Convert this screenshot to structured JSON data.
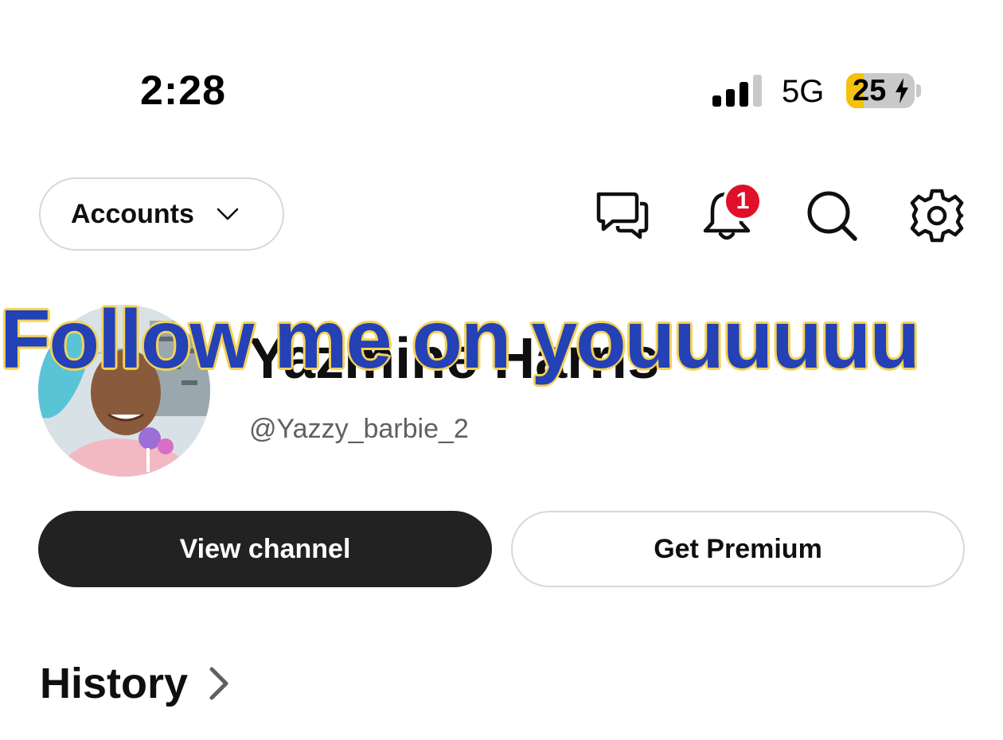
{
  "status_bar": {
    "time": "2:28",
    "network": "5G",
    "battery_level": "25",
    "battery_fraction": 0.25,
    "signal_bars_filled": 3,
    "signal_bars_total": 4
  },
  "header": {
    "accounts_label": "Accounts",
    "icons": [
      "messages-icon",
      "bell-icon",
      "search-icon",
      "gear-icon"
    ],
    "notification_count": "1"
  },
  "profile": {
    "name": "Yazmine Harris",
    "handle": "@Yazzy_barbie_2"
  },
  "overlay": {
    "caption": "Follow me on youuuuuu"
  },
  "actions": {
    "view_channel": "View channel",
    "get_premium": "Get Premium"
  },
  "sections": {
    "history_title": "History"
  },
  "colors": {
    "primary_button": "#222222",
    "badge": "#e0102a",
    "caption_fill": "#2441b5",
    "caption_stroke": "#f3d259",
    "battery_fill": "#f4c20d"
  }
}
